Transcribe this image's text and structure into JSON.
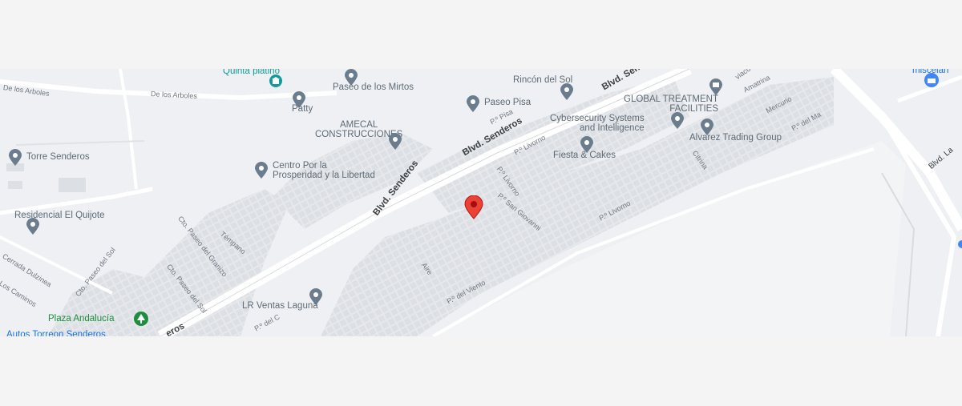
{
  "map": {
    "roads": {
      "main": "Blvd. Senderos",
      "main_b": "Blvd. Sende",
      "main_c": "Blvd. Senderos",
      "partial_left": "eros",
      "right": "Blvd. La"
    },
    "streets": {
      "arboles_1": "De los Arboles",
      "arboles_2": "De los Arboles",
      "pisa": "P.º Pisa",
      "livorno_1": "P.º Livorno",
      "livorno_2": "P.º Livorno",
      "livorno_3": "P.º Livorno",
      "san_giovanni": "P.º San Giovanni",
      "del_viento": "P.º del Viento",
      "aire": "Aire",
      "citrina": "Citrina",
      "mercurio": "Mercurio",
      "amatrina": "Amatrina",
      "del_mar": "P.º del Ma",
      "tempano": "Témpano",
      "granizo": "Cto. Paseo del Granizo",
      "paseo_sol_1": "Cto. Paseo del Sol",
      "paseo_sol_2": "Cto. Paseo del Sol",
      "cerrada_dulzinea": "Cerrada Dulzinea",
      "los_caminos": "Los Caminos",
      "del_c": "P.º del C",
      "viaco": "viaco"
    },
    "pois": {
      "quinta_platino": "Quinta platino",
      "paseo_mirtos": "Paseo de los Mirtos",
      "patty": "Patty",
      "rincon_sol": "Rincón del Sol",
      "global_treatment": "GLOBAL TREATMENT\nFACILITIES",
      "paseo_pisa": "Paseo Pisa",
      "amecal": "AMECAL\nCONSTRUCCIONES",
      "cybersecurity": "Cybersecurity Systems\nand Intelligence",
      "alvarez": "Alvarez Trading Group",
      "fiesta_cakes": "Fiesta & Cakes",
      "torre_senderos": "Torre Senderos",
      "centro_prosperidad": "Centro Por la\nProsperidad y la Libertad",
      "residencial_quijote": "Residencial El Quijote",
      "lr_ventas": "LR Ventas Laguna",
      "plaza_andalucia": "Plaza Andalucía",
      "autos_torreon": "Autos Torreon Senderos",
      "miscelanea": "miscelán"
    },
    "colors": {
      "background": "#eef0f3",
      "road": "#ffffff",
      "pin_gray": "#6b7d8c",
      "pin_red": "#ea4335",
      "park_green": "#1e8e3e",
      "school_teal": "#139b9b"
    }
  }
}
